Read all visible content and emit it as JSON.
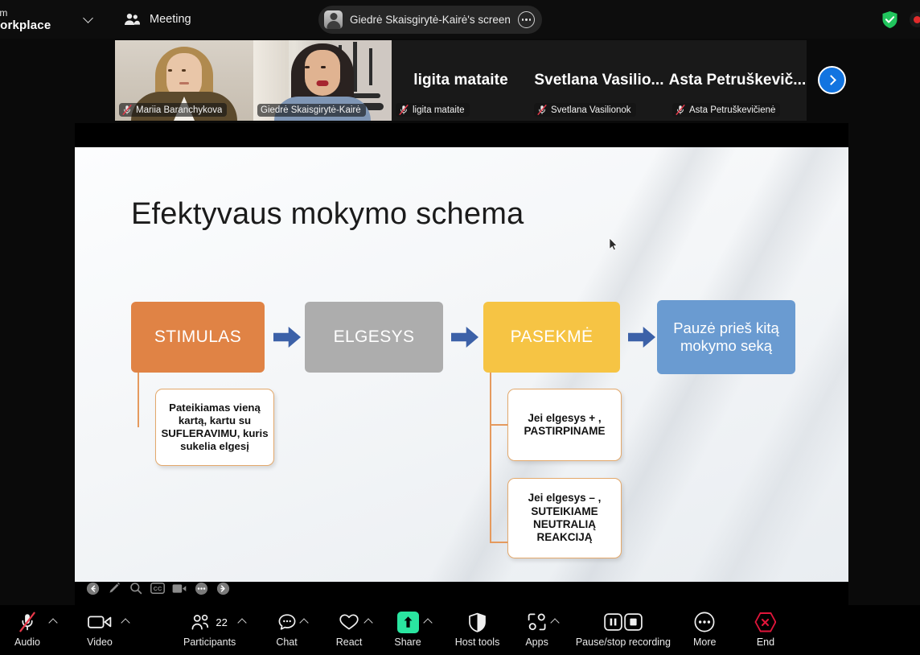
{
  "app": {
    "brand_line1": "oom",
    "brand_line2": "Workplace",
    "meeting_tab": "Meeting",
    "share_notice": "Giedrė Skaisgirytė-Kairė's screen",
    "encryption_icon": "green-shield-check-icon",
    "recording_icon": "recording-dot-icon"
  },
  "filmstrip": {
    "next_page_icon": "chevron-right-icon",
    "tiles": [
      {
        "name": "Mariia Baranchykova",
        "big_name": "",
        "video_on": true,
        "muted": true,
        "active": false
      },
      {
        "name": "Giedrė Skaisgirytė-Kairė",
        "big_name": "",
        "video_on": true,
        "muted": false,
        "active": true
      },
      {
        "name": "ligita mataite",
        "big_name": "ligita mataite",
        "video_on": false,
        "muted": true,
        "active": false
      },
      {
        "name": "Svetlana Vasilionok",
        "big_name": "Svetlana Vasilio...",
        "video_on": false,
        "muted": true,
        "active": false
      },
      {
        "name": "Asta Petruškevičienė",
        "big_name": "Asta Petruškevič...",
        "video_on": false,
        "muted": true,
        "active": false
      }
    ]
  },
  "slide": {
    "title": "Efektyvaus mokymo schema",
    "boxes": [
      {
        "label": "STIMULAS",
        "color": "#E08345"
      },
      {
        "label": "ELGESYS",
        "color": "#ADADAD"
      },
      {
        "label": "PASEKMĖ",
        "color": "#F6C444"
      },
      {
        "label": "Pauzė prieš kitą mokymo seką",
        "color": "#6A9BD1"
      }
    ],
    "callouts": [
      {
        "text": "Pateikiamas vieną kartą, kartu su SUFLERAVIMU, kuris sukelia elgesį"
      },
      {
        "text": "Jei elgesys + , PASTIRPINAME"
      },
      {
        "text": "Jei elgesys – , SUTEIKIAME NEUTRALIĄ REAKCIJĄ"
      }
    ],
    "arrow_color": "#3C61A8",
    "connector_color": "#E59A5E"
  },
  "slide_tools": [
    {
      "name": "previous-slide-icon",
      "glyph": "back-arrow"
    },
    {
      "name": "annotate-pen-icon",
      "glyph": "pen"
    },
    {
      "name": "zoom-search-icon",
      "glyph": "magnifier"
    },
    {
      "name": "closed-caption-icon",
      "glyph": "cc"
    },
    {
      "name": "video-icon",
      "glyph": "camcorder"
    },
    {
      "name": "more-options-icon",
      "glyph": "ellipsis"
    },
    {
      "name": "next-slide-icon",
      "glyph": "forward-arrow"
    }
  ],
  "toolbar": {
    "audio": {
      "label": "Audio",
      "muted": true,
      "has_caret": true
    },
    "video": {
      "label": "Video",
      "has_caret": true
    },
    "participants": {
      "label": "Participants",
      "count": "22",
      "has_caret": true
    },
    "chat": {
      "label": "Chat",
      "has_caret": true
    },
    "react": {
      "label": "React",
      "has_caret": true
    },
    "share": {
      "label": "Share",
      "has_caret": true,
      "accent": "#2ae5a0"
    },
    "host_tools": {
      "label": "Host tools",
      "has_caret": false
    },
    "apps": {
      "label": "Apps",
      "has_caret": true
    },
    "recording": {
      "label": "Pause/stop recording",
      "has_caret": false
    },
    "more": {
      "label": "More",
      "has_caret": false
    },
    "end": {
      "label": "End",
      "accent": "#e0153a"
    }
  }
}
